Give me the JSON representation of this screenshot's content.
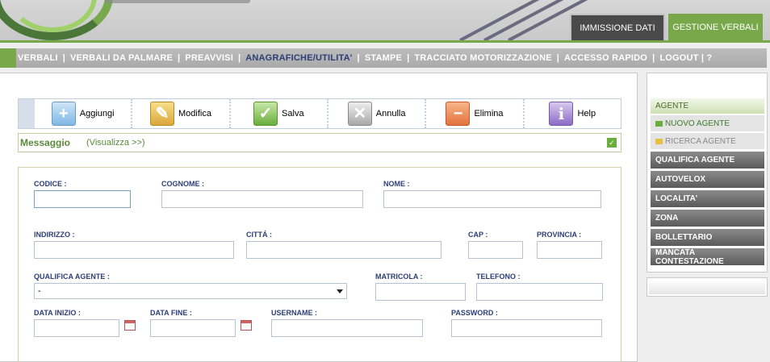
{
  "header": {
    "tabs": {
      "immissione": "IMMISSIONE DATI",
      "gestione": "GESTIONE VERBALI"
    }
  },
  "nav": {
    "items": [
      {
        "label": "VERBALI"
      },
      {
        "label": "VERBALI DA PALMARE"
      },
      {
        "label": "PREAVVISI"
      },
      {
        "label": "ANAGRAFICHE/UTILITA'"
      },
      {
        "label": "STAMPE"
      },
      {
        "label": "TRACCIATO MOTORIZZAZIONE"
      },
      {
        "label": "ACCESSO RAPIDO"
      },
      {
        "label": "LOGOUT | ?"
      }
    ]
  },
  "toolbar": {
    "add": "Aggiungi",
    "edit": "Modifica",
    "save": "Salva",
    "cancel": "Annulla",
    "delete": "Elimina",
    "help": "Help",
    "help_glyph": "i"
  },
  "message": {
    "title": "Messaggio",
    "link": "(Visualizza >>)"
  },
  "form": {
    "codice": "CODICE :",
    "cognome": "COGNOME :",
    "nome": "NOME :",
    "indirizzo": "INDIRIZZO :",
    "citta": "CITTÁ :",
    "cap": "CAP :",
    "provincia": "PROVINCIA :",
    "qualifica": "QUALIFICA AGENTE :",
    "qualifica_value": "-",
    "matricola": "MATRICOLA :",
    "telefono": "TELEFONO :",
    "data_inizio": "DATA INIZIO :",
    "data_fine": "DATA FINE :",
    "username": "USERNAME :",
    "password": "PASSWORD :"
  },
  "sidebar": {
    "section": "AGENTE",
    "sub": [
      {
        "label": "NUOVO AGENTE"
      },
      {
        "label": "RICERCA AGENTE"
      }
    ],
    "items": [
      {
        "label": "QUALIFICA AGENTE"
      },
      {
        "label": "AUTOVELOX"
      },
      {
        "label": "LOCALITA'"
      },
      {
        "label": "ZONA"
      },
      {
        "label": "BOLLETTARIO"
      },
      {
        "label": "MANCATA CONTESTAZIONE"
      }
    ]
  },
  "colors": {
    "accent": "#78a84a",
    "nav_active": "#2c3e78",
    "label": "#2c3e78"
  }
}
